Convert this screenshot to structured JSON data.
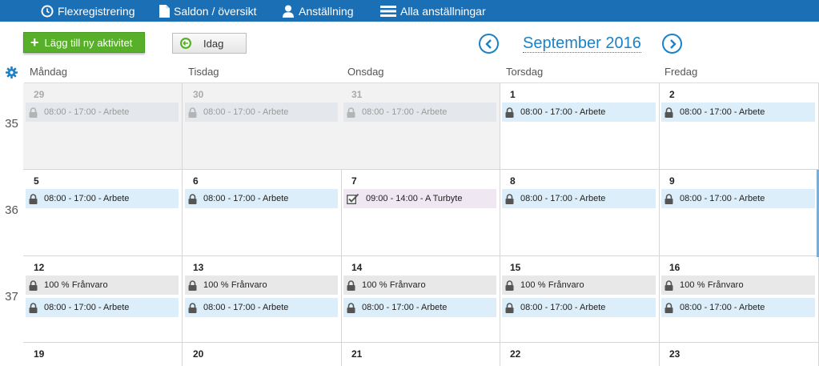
{
  "nav": {
    "items": [
      {
        "label": "Flexregistrering",
        "icon": "clock-icon"
      },
      {
        "label": "Saldon / översikt",
        "icon": "document-icon"
      },
      {
        "label": "Anställning",
        "icon": "user-icon"
      },
      {
        "label": "Alla anställningar",
        "icon": "list-icon"
      }
    ]
  },
  "toolbar": {
    "add_label": "Lägg till ny aktivitet",
    "today_label": "Idag",
    "month_title": "September 2016"
  },
  "days": [
    "Måndag",
    "Tisdag",
    "Onsdag",
    "Torsdag",
    "Fredag"
  ],
  "weeks": [
    {
      "number": "35",
      "cells": [
        {
          "day": "29",
          "other": true,
          "events": [
            {
              "type": "work",
              "icon": "lock-icon",
              "text": "08:00 - 17:00 - Arbete"
            }
          ]
        },
        {
          "day": "30",
          "other": true,
          "events": [
            {
              "type": "work",
              "icon": "lock-icon",
              "text": "08:00 - 17:00 - Arbete"
            }
          ]
        },
        {
          "day": "31",
          "other": true,
          "events": [
            {
              "type": "work",
              "icon": "lock-icon",
              "text": "08:00 - 17:00 - Arbete"
            }
          ]
        },
        {
          "day": "1",
          "other": false,
          "events": [
            {
              "type": "work",
              "icon": "lock-icon",
              "text": "08:00 - 17:00 - Arbete"
            }
          ]
        },
        {
          "day": "2",
          "other": false,
          "events": [
            {
              "type": "work",
              "icon": "lock-icon",
              "text": "08:00 - 17:00 - Arbete"
            }
          ]
        }
      ]
    },
    {
      "number": "36",
      "cells": [
        {
          "day": "5",
          "other": false,
          "events": [
            {
              "type": "work",
              "icon": "lock-icon",
              "text": "08:00 - 17:00 - Arbete"
            }
          ]
        },
        {
          "day": "6",
          "other": false,
          "events": [
            {
              "type": "work",
              "icon": "lock-icon",
              "text": "08:00 - 17:00 - Arbete"
            }
          ]
        },
        {
          "day": "7",
          "other": false,
          "events": [
            {
              "type": "swap",
              "icon": "checkbox-icon",
              "text": "09:00 - 14:00 - A Turbyte"
            }
          ]
        },
        {
          "day": "8",
          "other": false,
          "events": [
            {
              "type": "work",
              "icon": "lock-icon",
              "text": "08:00 - 17:00 - Arbete"
            }
          ]
        },
        {
          "day": "9",
          "other": false,
          "events": [
            {
              "type": "work",
              "icon": "lock-icon",
              "text": "08:00 - 17:00 - Arbete"
            }
          ]
        }
      ]
    },
    {
      "number": "37",
      "cells": [
        {
          "day": "12",
          "other": false,
          "events": [
            {
              "type": "abs",
              "icon": "lock-icon",
              "text": "100 %  Frånvaro"
            },
            {
              "type": "work",
              "icon": "lock-icon",
              "text": "08:00 - 17:00 - Arbete"
            }
          ]
        },
        {
          "day": "13",
          "other": false,
          "events": [
            {
              "type": "abs",
              "icon": "lock-icon",
              "text": "100 %  Frånvaro"
            },
            {
              "type": "work",
              "icon": "lock-icon",
              "text": "08:00 - 17:00 - Arbete"
            }
          ]
        },
        {
          "day": "14",
          "other": false,
          "events": [
            {
              "type": "abs",
              "icon": "lock-icon",
              "text": "100 %  Frånvaro"
            },
            {
              "type": "work",
              "icon": "lock-icon",
              "text": "08:00 - 17:00 - Arbete"
            }
          ]
        },
        {
          "day": "15",
          "other": false,
          "events": [
            {
              "type": "abs",
              "icon": "lock-icon",
              "text": "100 %  Frånvaro"
            },
            {
              "type": "work",
              "icon": "lock-icon",
              "text": "08:00 - 17:00 - Arbete"
            }
          ]
        },
        {
          "day": "16",
          "other": false,
          "events": [
            {
              "type": "abs",
              "icon": "lock-icon",
              "text": "100 %  Frånvaro"
            },
            {
              "type": "work",
              "icon": "lock-icon",
              "text": "08:00 - 17:00 - Arbete"
            }
          ]
        }
      ]
    },
    {
      "number": "",
      "cells": [
        {
          "day": "19",
          "other": false,
          "events": []
        },
        {
          "day": "20",
          "other": false,
          "events": []
        },
        {
          "day": "21",
          "other": false,
          "events": []
        },
        {
          "day": "22",
          "other": false,
          "events": []
        },
        {
          "day": "23",
          "other": false,
          "events": []
        }
      ]
    }
  ],
  "colors": {
    "nav_bg": "#1a6fb5",
    "accent": "#1a82c8",
    "add_button": "#58b02a",
    "work_event": "#dbeef9",
    "absence_event": "#e8e8e8",
    "swap_event": "#efe7f2",
    "other_month_bg": "#f2f2f2"
  }
}
